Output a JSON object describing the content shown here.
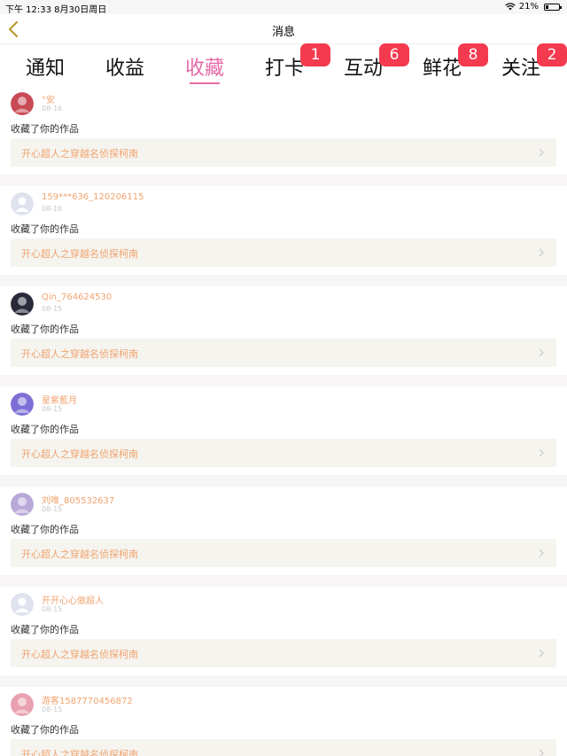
{
  "status_bar": {
    "time_date": "下午 12:33   8月30日周日",
    "battery": "21%",
    "battery_level": 0.21
  },
  "header": {
    "title": "消息"
  },
  "tabs": [
    {
      "label": "通知",
      "badge": ""
    },
    {
      "label": "收益",
      "badge": ""
    },
    {
      "label": "收藏",
      "badge": "",
      "active": true
    },
    {
      "label": "打卡",
      "badge": "1"
    },
    {
      "label": "互动",
      "badge": "6"
    },
    {
      "label": "鲜花",
      "badge": "8"
    },
    {
      "label": "关注",
      "badge": "2"
    }
  ],
  "colors": {
    "accent": "#e66aa8",
    "badge": "#f33a4f",
    "username": "#f0a36f",
    "work_bg": "#f5f4ef"
  },
  "feed": [
    {
      "username": "°安",
      "date": "08-16",
      "action": "收藏了你的作品",
      "work": "开心超人之穿越名侦探柯南",
      "avatar": "photo-avatar"
    },
    {
      "username": "159***636_120206115",
      "date": "08-16",
      "action": "收藏了你的作品",
      "work": "开心超人之穿越名侦探柯南",
      "avatar": "default-avatar"
    },
    {
      "username": "Qin_764624530",
      "date": "08-15",
      "action": "收藏了你的作品",
      "work": "开心超人之穿越名侦探柯南",
      "avatar": "photo-avatar"
    },
    {
      "username": "星紫藍月",
      "date": "08-15",
      "action": "收藏了你的作品",
      "work": "开心超人之穿越名侦探柯南",
      "avatar": "photo-avatar"
    },
    {
      "username": "刘唯_805532637",
      "date": "08-15",
      "action": "收藏了你的作品",
      "work": "开心超人之穿越名侦探柯南",
      "avatar": "photo-avatar"
    },
    {
      "username": "开开心心做超人",
      "date": "08-15",
      "action": "收藏了你的作品",
      "work": "开心超人之穿越名侦探柯南",
      "avatar": "default-avatar"
    },
    {
      "username": "游客1587770456872",
      "date": "08-15",
      "action": "收藏了你的作品",
      "work": "开心超人之穿越名侦探柯南",
      "avatar": "photo-avatar"
    }
  ]
}
